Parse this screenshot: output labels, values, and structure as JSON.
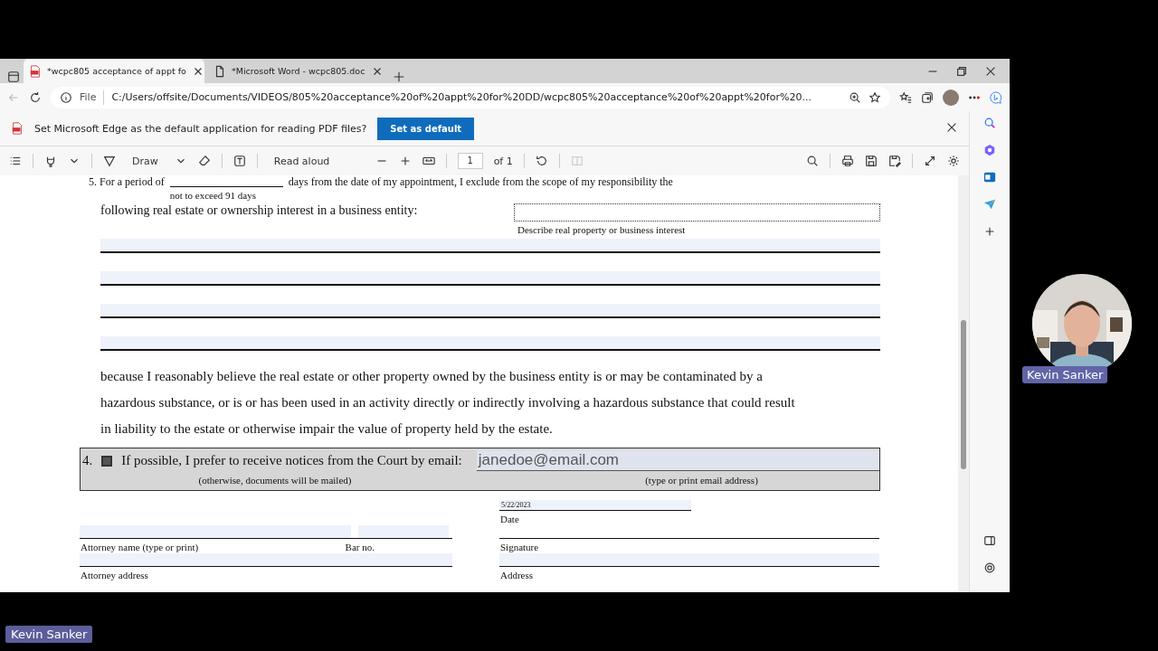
{
  "browser": {
    "tabs": [
      {
        "title": "*wcpc805 acceptance of appt fo",
        "kind": "pdf",
        "selected": true
      },
      {
        "title": "*Microsoft Word - wcpc805.doc",
        "kind": "doc",
        "selected": false
      }
    ],
    "address": {
      "scheme": "File",
      "url": "C:/Users/offsite/Documents/VIDEOS/805%20acceptance%20of%20appt%20for%20DD/wcpc805%20acceptance%20of%20appt%20for%20..."
    },
    "infobar": {
      "message": "Set Microsoft Edge as the default application for reading PDF files?",
      "button": "Set as default"
    },
    "pdf_toolbar": {
      "draw": "Draw",
      "read_aloud": "Read aloud",
      "page": "1",
      "page_count": "of 1"
    }
  },
  "document": {
    "item5_start": "5. For a period of",
    "item5_rest": "days from the date of my appointment, I exclude from the scope of my responsibility the",
    "days_note": "not to exceed 91 days",
    "item5_line2": "following real estate or ownership interest in a business entity:",
    "describe_label": "Describe real property or business interest",
    "paragraph": "because I reasonably believe the real estate or other property owned by the business entity is or may be contaminated by a hazardous substance, or is or has been used in an activity directly or indirectly involving a hazardous substance that could result in liability to the estate or otherwise impair the value of property held by the estate.",
    "item4": {
      "number": "4.",
      "checked": true,
      "text": "If possible, I prefer to receive notices from the Court by email:",
      "note": "(otherwise, documents will be mailed)",
      "email": "janedoe@email.com",
      "email_label": "(type or print email address)"
    },
    "date_value": "5/22/2023",
    "date_label": "Date",
    "attorney_name_label": "Attorney name (type or print)",
    "bar_label": "Bar no.",
    "signature_label": "Signature",
    "attorney_address_label": "Attorney address",
    "address_label": "Address"
  },
  "participant": {
    "name": "Kevin Sanker"
  },
  "speaker_label": "Kevin Sanker"
}
